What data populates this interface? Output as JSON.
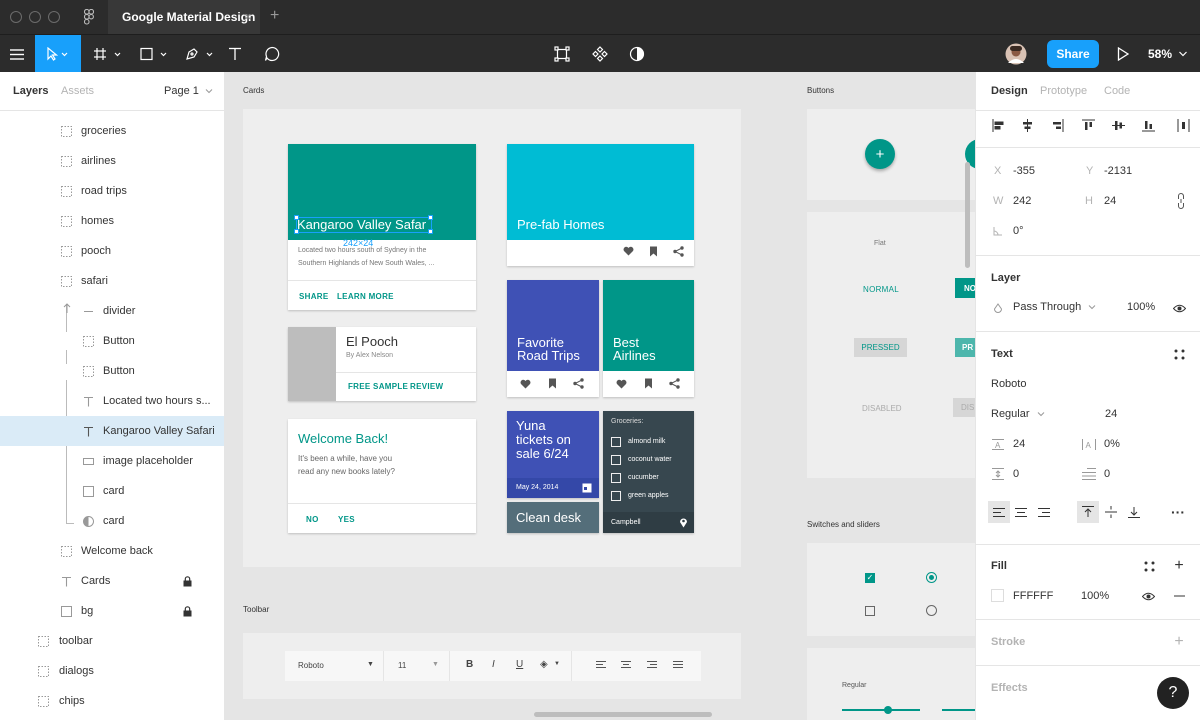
{
  "tab": {
    "title": "Google Material Design"
  },
  "toolbar": {
    "share_label": "Share",
    "zoom": "58%"
  },
  "left_panel": {
    "tabs": {
      "layers": "Layers",
      "assets": "Assets"
    },
    "page": "Page 1",
    "layers": [
      {
        "label": "groceries"
      },
      {
        "label": "airlines"
      },
      {
        "label": "road trips"
      },
      {
        "label": "homes"
      },
      {
        "label": "pooch"
      },
      {
        "label": "safari"
      },
      {
        "label": "divider"
      },
      {
        "label": "Button"
      },
      {
        "label": "Button"
      },
      {
        "label": "Located two hours s..."
      },
      {
        "label": "Kangaroo Valley Safari"
      },
      {
        "label": "image placeholder"
      },
      {
        "label": "card"
      },
      {
        "label": "card"
      },
      {
        "label": "Welcome back"
      },
      {
        "label": "Cards"
      },
      {
        "label": "bg"
      },
      {
        "label": "toolbar"
      },
      {
        "label": "dialogs"
      },
      {
        "label": "chips"
      }
    ]
  },
  "canvas": {
    "frames": {
      "cards": "Cards",
      "buttons": "Buttons",
      "toolbar": "Toolbar",
      "switches": "Switches and sliders"
    },
    "safari": {
      "title": "Kangaroo Valley Safar",
      "size_badge": "242×24",
      "body": "Located two hours south of Sydney in the",
      "body2": "Southern Highlands of New South Wales, ...",
      "share": "SHARE",
      "learn": "LEARN MORE"
    },
    "prefab": {
      "title": "Pre-fab Homes"
    },
    "pooch": {
      "title": "El Pooch",
      "author": "By Alex Nelson",
      "sample": "FREE SAMPLE",
      "review": "REVIEW"
    },
    "road": {
      "line1": "Favorite",
      "line2": "Road Trips"
    },
    "airlines": {
      "line1": "Best",
      "line2": "Airlines"
    },
    "welcome": {
      "title": "Welcome Back!",
      "body1": "It's been a while, have you",
      "body2": "read any new books lately?",
      "no": "NO",
      "yes": "YES"
    },
    "yuna": {
      "l1": "Yuna",
      "l2": "tickets on",
      "l3": "sale 6/24",
      "date": "May 24, 2014"
    },
    "groceries": {
      "header": "Groceries:",
      "items": [
        "almond milk",
        "coconut water",
        "cucumber",
        "green apples"
      ],
      "footer": "Campbell"
    },
    "clean": {
      "title": "Clean desk"
    },
    "buttons": {
      "flat": "Flat",
      "normal": "NORMAL",
      "pressed": "PRESSED",
      "disabled": "DISABLED",
      "no": "NO",
      "pr": "PR",
      "dis": "DIS"
    },
    "tbar": {
      "font": "Roboto",
      "size": "11"
    },
    "sliders": {
      "regular": "Regular"
    }
  },
  "right_panel": {
    "tabs": {
      "design": "Design",
      "prototype": "Prototype",
      "code": "Code"
    },
    "x_label": "X",
    "x": "-355",
    "y_label": "Y",
    "y": "-2131",
    "w_label": "W",
    "w": "242",
    "h_label": "H",
    "h": "24",
    "rotation": "0°",
    "layer_title": "Layer",
    "blend": "Pass Through",
    "opacity": "100%",
    "text_title": "Text",
    "font": "Roboto",
    "weight": "Regular",
    "font_size": "24",
    "line_height": "24",
    "letter_spacing": "0%",
    "para_spacing": "0",
    "para_indent": "0",
    "fill_title": "Fill",
    "fill_hex": "FFFFFF",
    "fill_opacity": "100%",
    "stroke_title": "Stroke",
    "effects_title": "Effects"
  },
  "colors": {
    "teal": "#009688",
    "cyan": "#00bcd4",
    "indigo": "#3f51b5",
    "slate": "#37474f",
    "accent": "#18a0fb"
  }
}
